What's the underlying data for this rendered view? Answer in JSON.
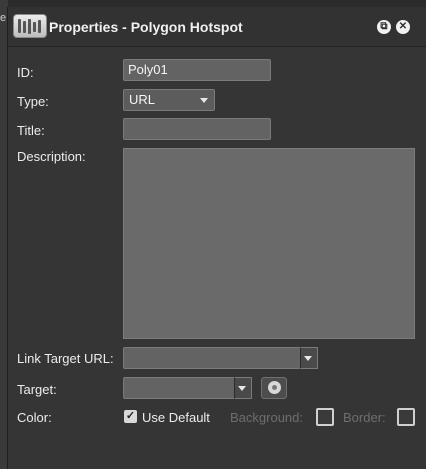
{
  "window": {
    "title": "Properties - Polygon Hotspot"
  },
  "icons": {
    "app": "equalizer-app-icon",
    "restore": "restore-window-icon",
    "close": "close-icon",
    "target": "target-picker-icon",
    "dropdown": "chevron-down-icon"
  },
  "background": {
    "edge_glyph": "e"
  },
  "form": {
    "id": {
      "label": "ID:",
      "value": "Poly01"
    },
    "type": {
      "label": "Type:",
      "value": "URL"
    },
    "title": {
      "label": "Title:",
      "value": ""
    },
    "description": {
      "label": "Description:",
      "value": ""
    },
    "link_target_url": {
      "label": "Link Target URL:",
      "value": ""
    },
    "target": {
      "label": "Target:",
      "value": ""
    },
    "color": {
      "label": "Color:",
      "use_default_label": "Use Default",
      "use_default_checked": true,
      "background_label": "Background:",
      "border_label": "Border:"
    }
  },
  "colors": {
    "panel": "#353535",
    "field": "#636363",
    "text": "#ececec",
    "disabled_text": "#6e6e6e"
  }
}
